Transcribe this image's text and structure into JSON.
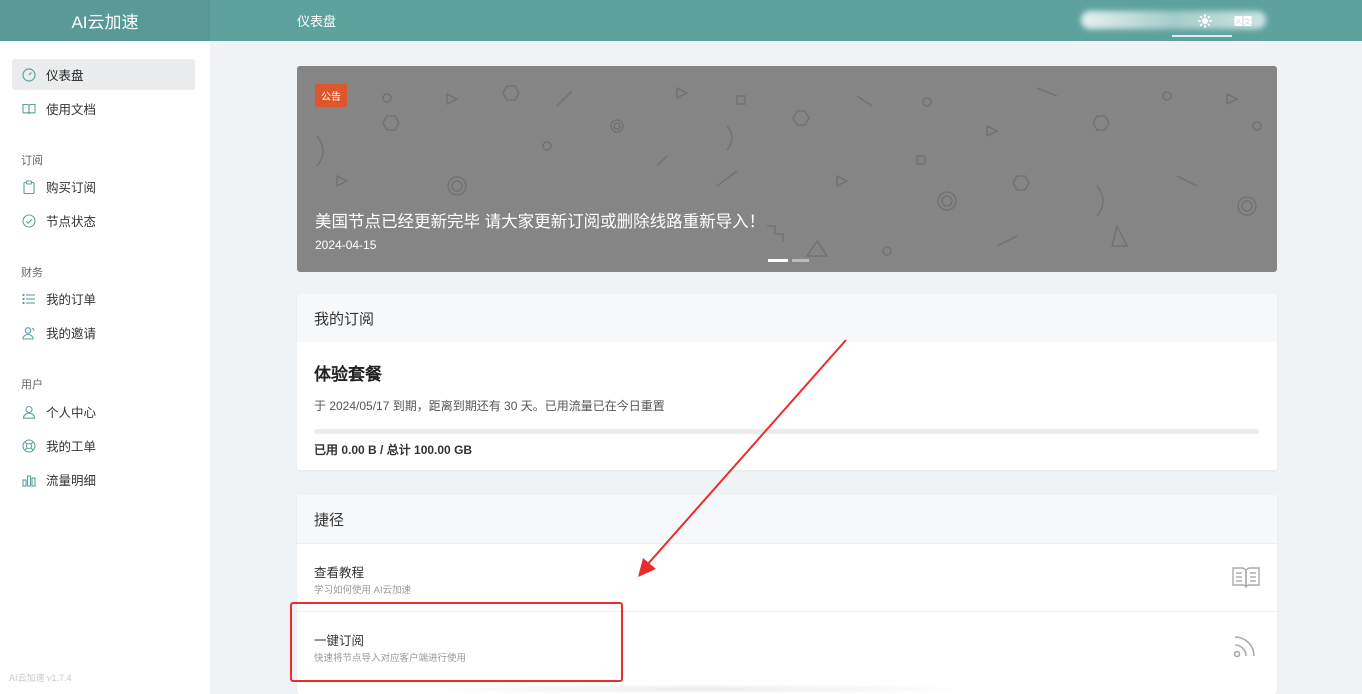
{
  "brand": "AI云加速",
  "header": {
    "page_title": "仪表盘"
  },
  "sidebar": {
    "items": [
      {
        "label": "仪表盘",
        "icon": "dashboard-icon",
        "active": true
      },
      {
        "label": "使用文档",
        "icon": "book-icon"
      }
    ],
    "sections": [
      {
        "title": "订阅",
        "items": [
          {
            "label": "购买订阅",
            "icon": "clipboard-icon"
          },
          {
            "label": "节点状态",
            "icon": "check-circle-icon"
          }
        ]
      },
      {
        "title": "财务",
        "items": [
          {
            "label": "我的订单",
            "icon": "list-icon"
          },
          {
            "label": "我的邀请",
            "icon": "users-icon"
          }
        ]
      },
      {
        "title": "用户",
        "items": [
          {
            "label": "个人中心",
            "icon": "user-icon"
          },
          {
            "label": "我的工单",
            "icon": "support-icon"
          },
          {
            "label": "流量明细",
            "icon": "bar-chart-icon"
          }
        ]
      }
    ],
    "version": "AI云加速 v1.7.4"
  },
  "notice": {
    "badge": "公告",
    "title": "美国节点已经更新完毕 请大家更新订阅或删除线路重新导入！",
    "date": "2024-04-15",
    "slides_total": 2,
    "slide_active": 1
  },
  "subscription": {
    "card_title": "我的订阅",
    "plan_name": "体验套餐",
    "description": "于 2024/05/17 到期，距离到期还有 30 天。已用流量已在今日重置",
    "usage_text": "已用 0.00 B / 总计 100.00 GB",
    "usage_fraction": 0
  },
  "shortcuts": {
    "card_title": "捷径",
    "items": [
      {
        "title": "查看教程",
        "subtitle": "学习如何使用 AI云加速",
        "icon": "book-open-icon"
      },
      {
        "title": "一键订阅",
        "subtitle": "快速将节点导入对应客户端进行使用",
        "icon": "rss-icon"
      }
    ]
  },
  "colors": {
    "header": "#5ea29d",
    "brand_bg": "#5a9a96",
    "badge": "#e0562c",
    "annotation": "#e92c2c"
  }
}
